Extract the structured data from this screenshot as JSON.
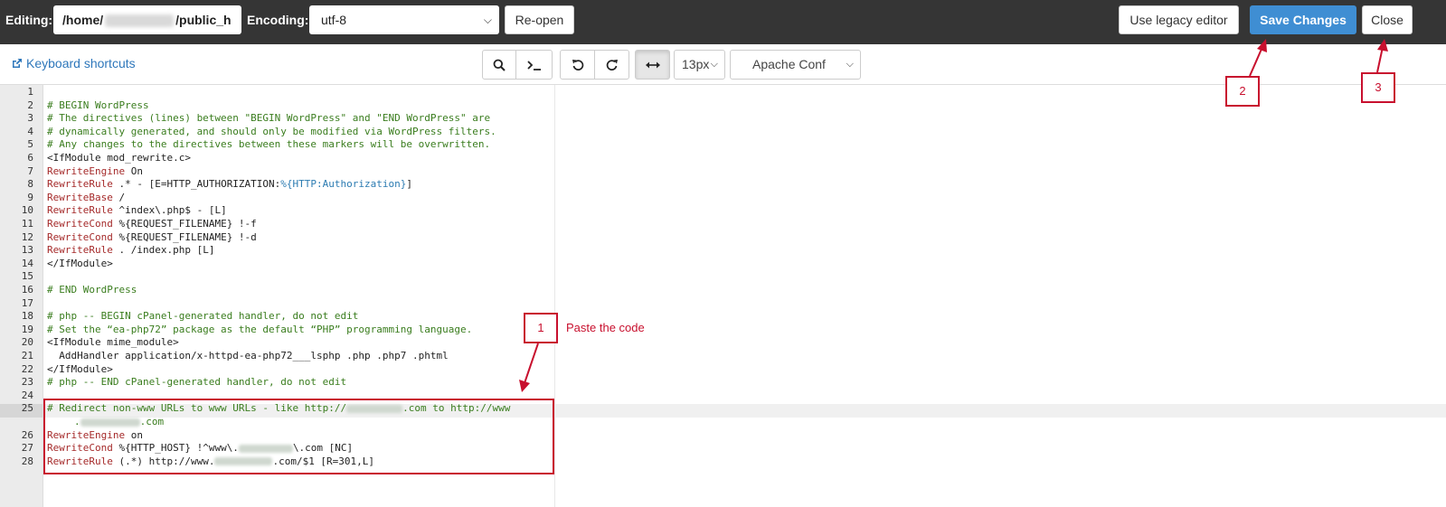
{
  "topbar": {
    "editing_label": "Editing:",
    "path_prefix": "/home/",
    "path_suffix": "/public_h",
    "encoding_label": "Encoding:",
    "encoding_value": "utf-8",
    "reopen_label": "Re-open",
    "legacy_label": "Use legacy editor",
    "save_label": "Save Changes",
    "close_label": "Close"
  },
  "toolbar": {
    "shortcuts_label": "Keyboard shortcuts",
    "font_size": "13px",
    "mode": "Apache Conf"
  },
  "editor": {
    "line_numbers": [
      "1",
      "2",
      "3",
      "4",
      "5",
      "6",
      "7",
      "8",
      "9",
      "10",
      "11",
      "12",
      "13",
      "14",
      "15",
      "16",
      "17",
      "18",
      "19",
      "20",
      "21",
      "22",
      "23",
      "24",
      "25",
      "",
      "26",
      "27",
      "28"
    ],
    "current_line": "25",
    "lines": {
      "l2": "# BEGIN WordPress",
      "l3": "# The directives (lines) between \"BEGIN WordPress\" and \"END WordPress\" are",
      "l4": "# dynamically generated, and should only be modified via WordPress filters.",
      "l5": "# Any changes to the directives between these markers will be overwritten.",
      "l6": "<IfModule mod_rewrite.c>",
      "l7_kw": "RewriteEngine",
      "l7_rest": " On",
      "l8_kw": "RewriteRule",
      "l8_rest": " .* - [E=HTTP_AUTHORIZATION:",
      "l8_var": "%{HTTP:Authorization}",
      "l8_end": "]",
      "l9_kw": "RewriteBase",
      "l9_rest": " /",
      "l10_kw": "RewriteRule",
      "l10_rest": " ^index\\.php$ - [L]",
      "l11_kw": "RewriteCond",
      "l11_rest": " %{REQUEST_FILENAME} !-f",
      "l12_kw": "RewriteCond",
      "l12_rest": " %{REQUEST_FILENAME} !-d",
      "l13_kw": "RewriteRule",
      "l13_rest": " . /index.php [L]",
      "l14": "</IfModule>",
      "l16": "# END WordPress",
      "l18": "# php -- BEGIN cPanel-generated handler, do not edit",
      "l19": "# Set the “ea-php72” package as the default “PHP” programming language.",
      "l20": "<IfModule mime_module>",
      "l21": "  AddHandler application/x-httpd-ea-php72___lsphp .php .php7 .phtml",
      "l22": "</IfModule>",
      "l23": "# php -- END cPanel-generated handler, do not edit",
      "l25_a": "# Redirect non-www URLs to www URLs - like http://",
      "l25_b": ".com to http://www",
      "l25w_a": ".",
      "l25w_b": ".com",
      "l26_kw": "RewriteEngine",
      "l26_rest": " on",
      "l27_kw": "RewriteCond",
      "l27_a": " %{HTTP_HOST} !^www\\.",
      "l27_b": "\\.com [NC]",
      "l28_kw": "RewriteRule",
      "l28_a": " (.*) http://www.",
      "l28_b": ".com/$1 [R=301,L]"
    }
  },
  "annotations": {
    "n1": "1",
    "n2": "2",
    "n3": "3",
    "paste_text": "Paste the code",
    "color": "#c8102e"
  }
}
